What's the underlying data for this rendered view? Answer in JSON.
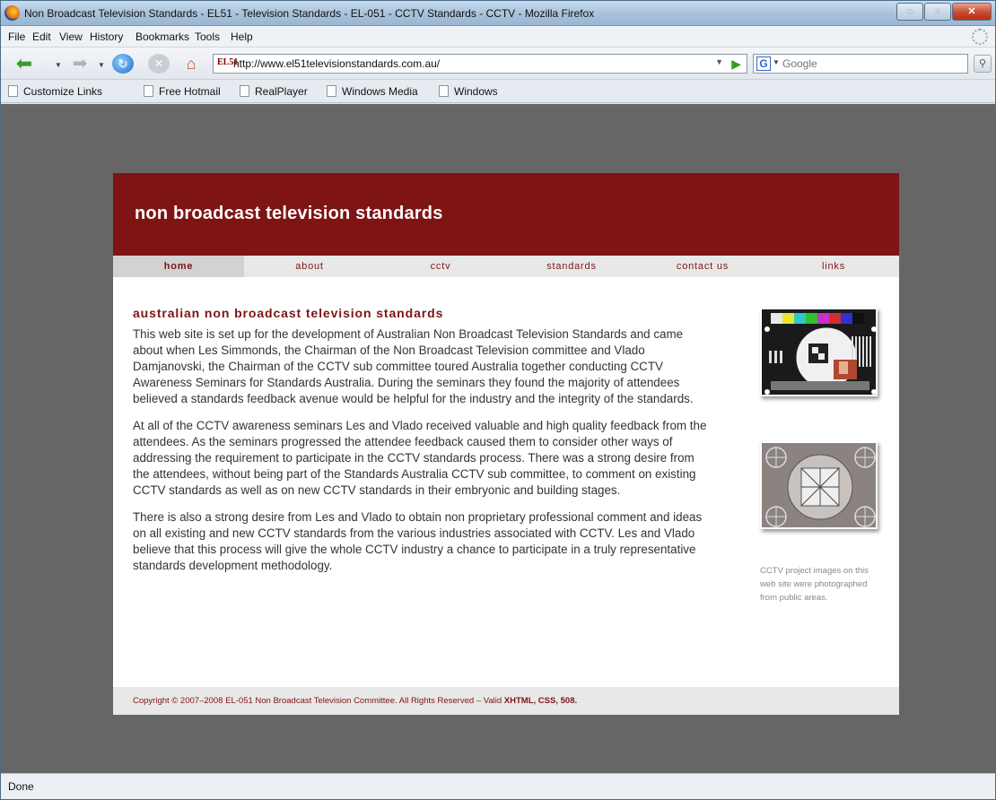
{
  "window": {
    "title": "Non Broadcast Television Standards - EL51 - Television Standards - EL-051 - CCTV Standards - CCTV - Mozilla Firefox"
  },
  "menubar": {
    "items": [
      "File",
      "Edit",
      "View",
      "History",
      "Bookmarks",
      "Tools",
      "Help"
    ]
  },
  "navbar": {
    "url": "http://www.el51televisionstandards.com.au/",
    "url_favicon": "EL51",
    "search_placeholder": "Google",
    "search_engine": "G"
  },
  "bookmarks": [
    "Customize Links",
    "Free Hotmail",
    "RealPlayer",
    "Windows Media",
    "Windows"
  ],
  "site": {
    "title": "non broadcast television standards",
    "nav": [
      "home",
      "about",
      "cctv",
      "standards",
      "contact us",
      "links"
    ],
    "active_nav": "home",
    "heading": "australian non broadcast television standards",
    "paragraphs": [
      "This web site is set up for the development of Australian Non Broadcast Television Standards and came about when Les Simmonds, the Chairman of the Non Broadcast Television committee and Vlado Damjanovski, the Chairman of the CCTV sub committee toured Australia together conducting CCTV Awareness Seminars for Standards Australia. During the seminars they found the majority of attendees believed a standards feedback avenue would be helpful for the industry and the integrity of the standards.",
      "At all of the CCTV awareness seminars Les and Vlado received valuable and high quality feedback from the attendees. As the seminars progressed the attendee feedback caused them to consider other ways of addressing the requirement to participate in the CCTV standards process. There was a strong desire from the attendees, without being part of the Standards Australia CCTV sub committee, to comment on existing CCTV standards as well as on new CCTV standards in their embryonic and building stages.",
      "There is also a strong desire from Les and Vlado to obtain non proprietary professional comment and ideas on all existing and new CCTV standards from the various industries associated with CCTV. Les and Vlado believe that this process will give the whole CCTV industry a chance to participate in a truly representative standards development methodology."
    ],
    "caption": "CCTV project images on this web site were photographed from public areas.",
    "footer": {
      "text": "Copyright © 2007–2008 EL-051 Non Broadcast Television Committee. All Rights Reserved – Valid ",
      "links": [
        "XHTML",
        "CSS",
        "508"
      ]
    }
  },
  "statusbar": {
    "text": "Done"
  },
  "colors": {
    "brand": "#7e1414",
    "viewport_bg": "#666666",
    "nav_bg": "#e8e8e8"
  }
}
